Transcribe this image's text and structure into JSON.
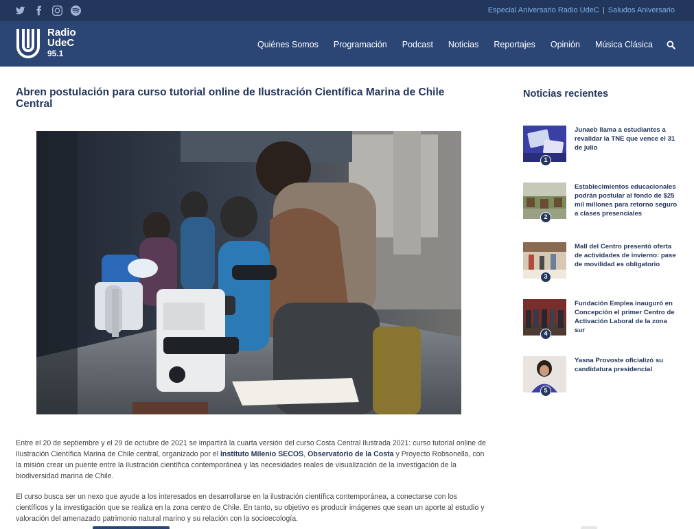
{
  "topbar": {
    "social_icons": [
      "twitter-icon",
      "facebook-icon",
      "instagram-icon",
      "spotify-icon"
    ],
    "link1": "Especial Aniversario Radio UdeC",
    "separator": "|",
    "link2": "Saludos Aniversario"
  },
  "header": {
    "logo_line1": "Radio",
    "logo_line2": "UdeC",
    "logo_freq": "95.1",
    "nav": [
      "Quiénes Somos",
      "Programación",
      "Podcast",
      "Noticias",
      "Reportajes",
      "Opinión",
      "Música Clásica"
    ],
    "search_icon": "search-icon"
  },
  "article": {
    "title": "Abren postulación para curso tutorial online de Ilustración Científica Marina de Chile Central",
    "p1_a": "Entre el 20 de septiembre y el 29 de octubre de 2021 se impartirá la cuarta versión del curso Costa Central Ilustrada 2021: curso tutorial online de Ilustración Científica Marina de Chile central, organizado por el ",
    "p1_b": "Instituto Milenio SECOS",
    "p1_c": ", ",
    "p1_d": "Observatorio de la Costa",
    "p1_e": " y Proyecto Robsonella, con la misión crear un puente entre la ilustración científica contemporánea y las necesidades reales de visualización de la investigación de la biodiversidad marina de Chile.",
    "p2": "El curso busca ser un nexo que ayude a los interesados en desarrollarse en la ilustración científica contemporánea, a conectarse con los científicos y la investigación que se realiza en la zona centro de Chile. En tanto, su objetivo es producir imágenes que sean un aporte al estudio y valoración del amenazado patrimonio natural marino y su relación con la socioecología."
  },
  "sidebar": {
    "title": "Noticias recientes",
    "items": [
      {
        "num": "1",
        "text": "Junaeb llama a estudiantes a revalidar la TNE que vence el 31 de julio"
      },
      {
        "num": "2",
        "text": "Establecimientos educacionales podrán postular al fondo de $25 mil millones para retorno seguro a clases presenciales"
      },
      {
        "num": "3",
        "text": "Mall del Centro presentó oferta de actividades de invierno: pase de movilidad es obligatorio"
      },
      {
        "num": "4",
        "text": "Fundación Emplea inauguró en Concepción el primer Centro de Activación Laboral de la zona sur"
      },
      {
        "num": "5",
        "text": "Yasna Provoste oficializó su candidatura presidencial"
      }
    ]
  },
  "colors": {
    "topbar": "#23365c",
    "header": "#2b4575",
    "accent_link": "#7fb2e8",
    "title": "#23365c"
  }
}
